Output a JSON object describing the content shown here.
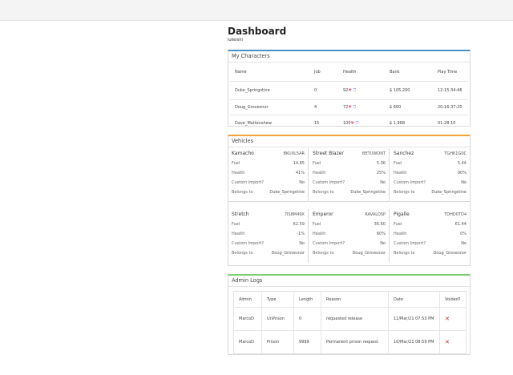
{
  "header": {
    "title": "Dashboard",
    "username": "lukeishi"
  },
  "colors": {
    "characters_accent": "#4a90c8",
    "vehicles_accent": "#f0a23c",
    "admin_accent": "#7ccf71",
    "void_mark": "#c0282d"
  },
  "characters": {
    "title": "My Characters",
    "columns": [
      "Name",
      "Job",
      "Health",
      "Bank",
      "Play Time"
    ],
    "rows": [
      {
        "name": "Duke_Springstine",
        "job": "0",
        "health": "92",
        "bank": "$ 105,200",
        "play_time": "12:15:34:46"
      },
      {
        "name": "Doug_Grovesnor",
        "job": "4",
        "health": "72",
        "bank": "$ 660",
        "play_time": "20:16:37:20"
      },
      {
        "name": "Dave_Mattenshew",
        "job": "15",
        "health": "100",
        "bank": "$ 1,968",
        "play_time": "01:28:10"
      }
    ]
  },
  "vehicles": {
    "title": "Vehicles",
    "labels": {
      "fuel": "Fuel",
      "health": "Health",
      "custom_import": "Custom Import?",
      "belongs_to": "Belongs to"
    },
    "items": [
      {
        "name": "Kamacho",
        "plate": "BKUXL5AR",
        "fuel": "14.85",
        "health": "41%",
        "custom_import": "No",
        "owner": "Duke_Springstine"
      },
      {
        "name": "Street Blazer",
        "plate": "BETUWONT",
        "fuel": "5.06",
        "health": "25%",
        "custom_import": "No",
        "owner": "Duke_Springstine"
      },
      {
        "name": "Sanchez",
        "plate": "TGHK1G0C",
        "fuel": "5.44",
        "health": "90%",
        "custom_import": "No",
        "owner": "Duke_Springstine"
      },
      {
        "name": "Stretch",
        "plate": "7IS8M49X",
        "fuel": "62.59",
        "health": "-1%",
        "custom_import": "No",
        "owner": "Doug_Grovesnor"
      },
      {
        "name": "Emperor",
        "plate": "RAVALOSP",
        "fuel": "36.60",
        "health": "60%",
        "custom_import": "No",
        "owner": "Doug_Grovesnor"
      },
      {
        "name": "Pigalle",
        "plate": "TDHD0TD4",
        "fuel": "61.44",
        "health": "0%",
        "custom_import": "No",
        "owner": "Doug_Grovesnor"
      }
    ]
  },
  "admin_logs": {
    "title": "Admin Logs",
    "columns": [
      "Admin",
      "Type",
      "Length",
      "Reason",
      "Date",
      "Voided?"
    ],
    "rows": [
      {
        "admin": "MarcoD",
        "type": "UnPrison",
        "length": "0",
        "reason": "requested release",
        "date": "11/Mar/21 07:53 PM",
        "voided": "✕"
      },
      {
        "admin": "MarcoD",
        "type": "Prison",
        "length": "9999",
        "reason": "Permanent prison request",
        "date": "10/Mar/21 08:59 PM",
        "voided": "✕"
      }
    ]
  }
}
